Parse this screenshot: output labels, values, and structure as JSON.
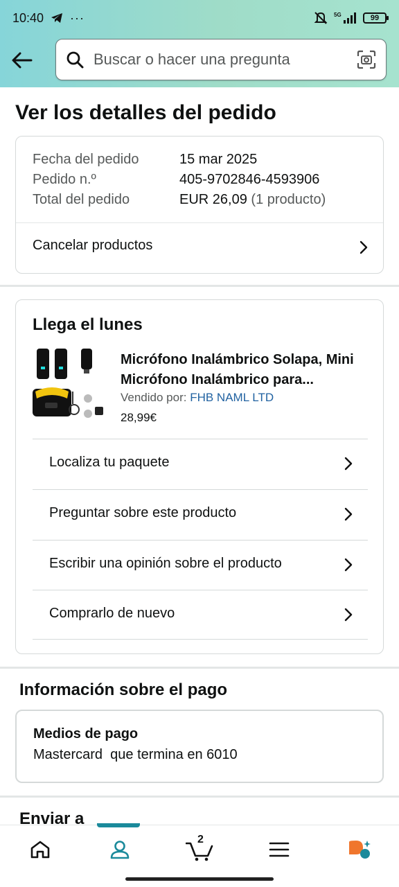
{
  "status_bar": {
    "time": "10:40",
    "battery": "99",
    "network": "5G"
  },
  "search": {
    "placeholder": "Buscar o hacer una pregunta"
  },
  "page": {
    "title": "Ver los detalles del pedido"
  },
  "order_summary": {
    "date_label": "Fecha del pedido",
    "date_value": "15 mar 2025",
    "order_label": "Pedido n.º",
    "order_value": "405-9702846-4593906",
    "total_label": "Total del pedido",
    "total_value": "EUR 26,09",
    "total_count": "(1 producto)",
    "cancel_label": "Cancelar productos"
  },
  "shipment": {
    "heading": "Llega el lunes",
    "product_title": "Micrófono Inalámbrico Solapa, Mini Micrófono Inalámbrico para...",
    "sold_by_label": "Vendido por:",
    "seller": "FHB NAML LTD",
    "price": "28,99€",
    "actions": [
      {
        "label": "Localiza tu paquete"
      },
      {
        "label": "Preguntar sobre este producto"
      },
      {
        "label": "Escribir una opinión sobre el producto"
      },
      {
        "label": "Comprarlo de nuevo"
      }
    ]
  },
  "payment": {
    "section_title": "Información sobre el pago",
    "methods_title": "Medios de pago",
    "methods_value": "Mastercard  que termina en 6010"
  },
  "shipping": {
    "section_title": "Enviar a"
  },
  "bottom_nav": {
    "cart_count": "2"
  },
  "colors": {
    "accent": "#1b8a9b",
    "link": "#2162a1",
    "header_gradient_start": "#86d5d9",
    "header_gradient_end": "#a6e3cf"
  }
}
